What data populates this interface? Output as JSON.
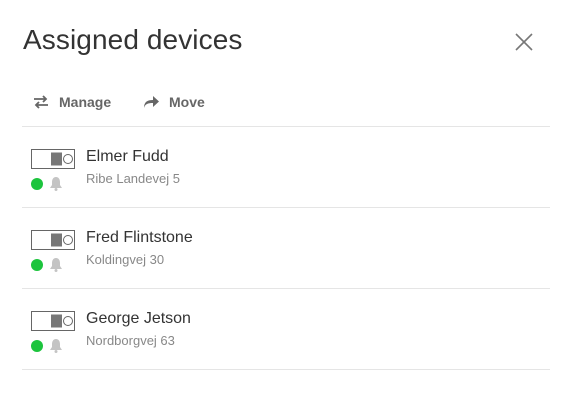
{
  "dialog": {
    "title": "Assigned devices",
    "close_icon": "close-icon"
  },
  "toolbar": {
    "manage_label": "Manage",
    "manage_icon": "swap-arrows-icon",
    "move_label": "Move",
    "move_icon": "forward-arrow-icon"
  },
  "devices": [
    {
      "name": "Elmer Fudd",
      "address": "Ribe Landevej 5",
      "status": "online",
      "status_color": "#1cc43d",
      "device_icon": "device-switch-icon",
      "alarm_icon": "bell-icon"
    },
    {
      "name": "Fred Flintstone",
      "address": "Koldingvej 30",
      "status": "online",
      "status_color": "#1cc43d",
      "device_icon": "device-switch-icon",
      "alarm_icon": "bell-icon"
    },
    {
      "name": "George Jetson",
      "address": "Nordborgvej 63",
      "status": "online",
      "status_color": "#1cc43d",
      "device_icon": "device-switch-icon",
      "alarm_icon": "bell-icon"
    }
  ]
}
